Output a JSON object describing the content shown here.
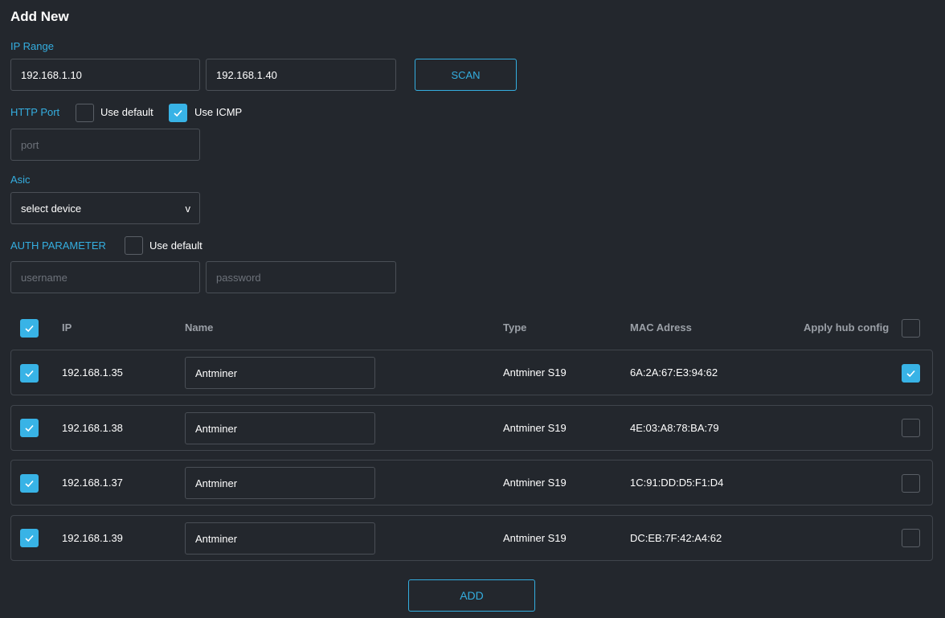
{
  "title": "Add New",
  "ip_range": {
    "label": "IP Range",
    "start": "192.168.1.10",
    "end": "192.168.1.40",
    "scan_label": "SCAN"
  },
  "http_port": {
    "label": "HTTP Port",
    "use_default_label": "Use default",
    "use_default_checked": false,
    "use_icmp_label": "Use ICMP",
    "use_icmp_checked": true,
    "port_placeholder": "port"
  },
  "asic": {
    "label": "Asic",
    "selected": "select device",
    "chevron": "v"
  },
  "auth": {
    "label": "AUTH PARAMETER",
    "use_default_label": "Use default",
    "use_default_checked": false,
    "username_placeholder": "username",
    "password_placeholder": "password"
  },
  "table": {
    "select_all_checked": true,
    "headers": {
      "ip": "IP",
      "name": "Name",
      "type": "Type",
      "mac": "MAC Adress",
      "apply_hub": "Apply hub config"
    },
    "apply_hub_all_checked": false,
    "rows": [
      {
        "checked": true,
        "ip": "192.168.1.35",
        "name": "Antminer",
        "type": "Antminer S19",
        "mac": "6A:2A:67:E3:94:62",
        "apply_hub": true
      },
      {
        "checked": true,
        "ip": "192.168.1.38",
        "name": "Antminer",
        "type": "Antminer S19",
        "mac": "4E:03:A8:78:BA:79",
        "apply_hub": false
      },
      {
        "checked": true,
        "ip": "192.168.1.37",
        "name": "Antminer",
        "type": "Antminer S19",
        "mac": "1C:91:DD:D5:F1:D4",
        "apply_hub": false
      },
      {
        "checked": true,
        "ip": "192.168.1.39",
        "name": "Antminer",
        "type": "Antminer S19",
        "mac": "DC:EB:7F:42:A4:62",
        "apply_hub": false
      }
    ]
  },
  "add_label": "ADD",
  "colors": {
    "background": "#23272d",
    "accent": "#34aee0",
    "checkbox_checked": "#38b3e6",
    "border": "#4a4f56"
  }
}
